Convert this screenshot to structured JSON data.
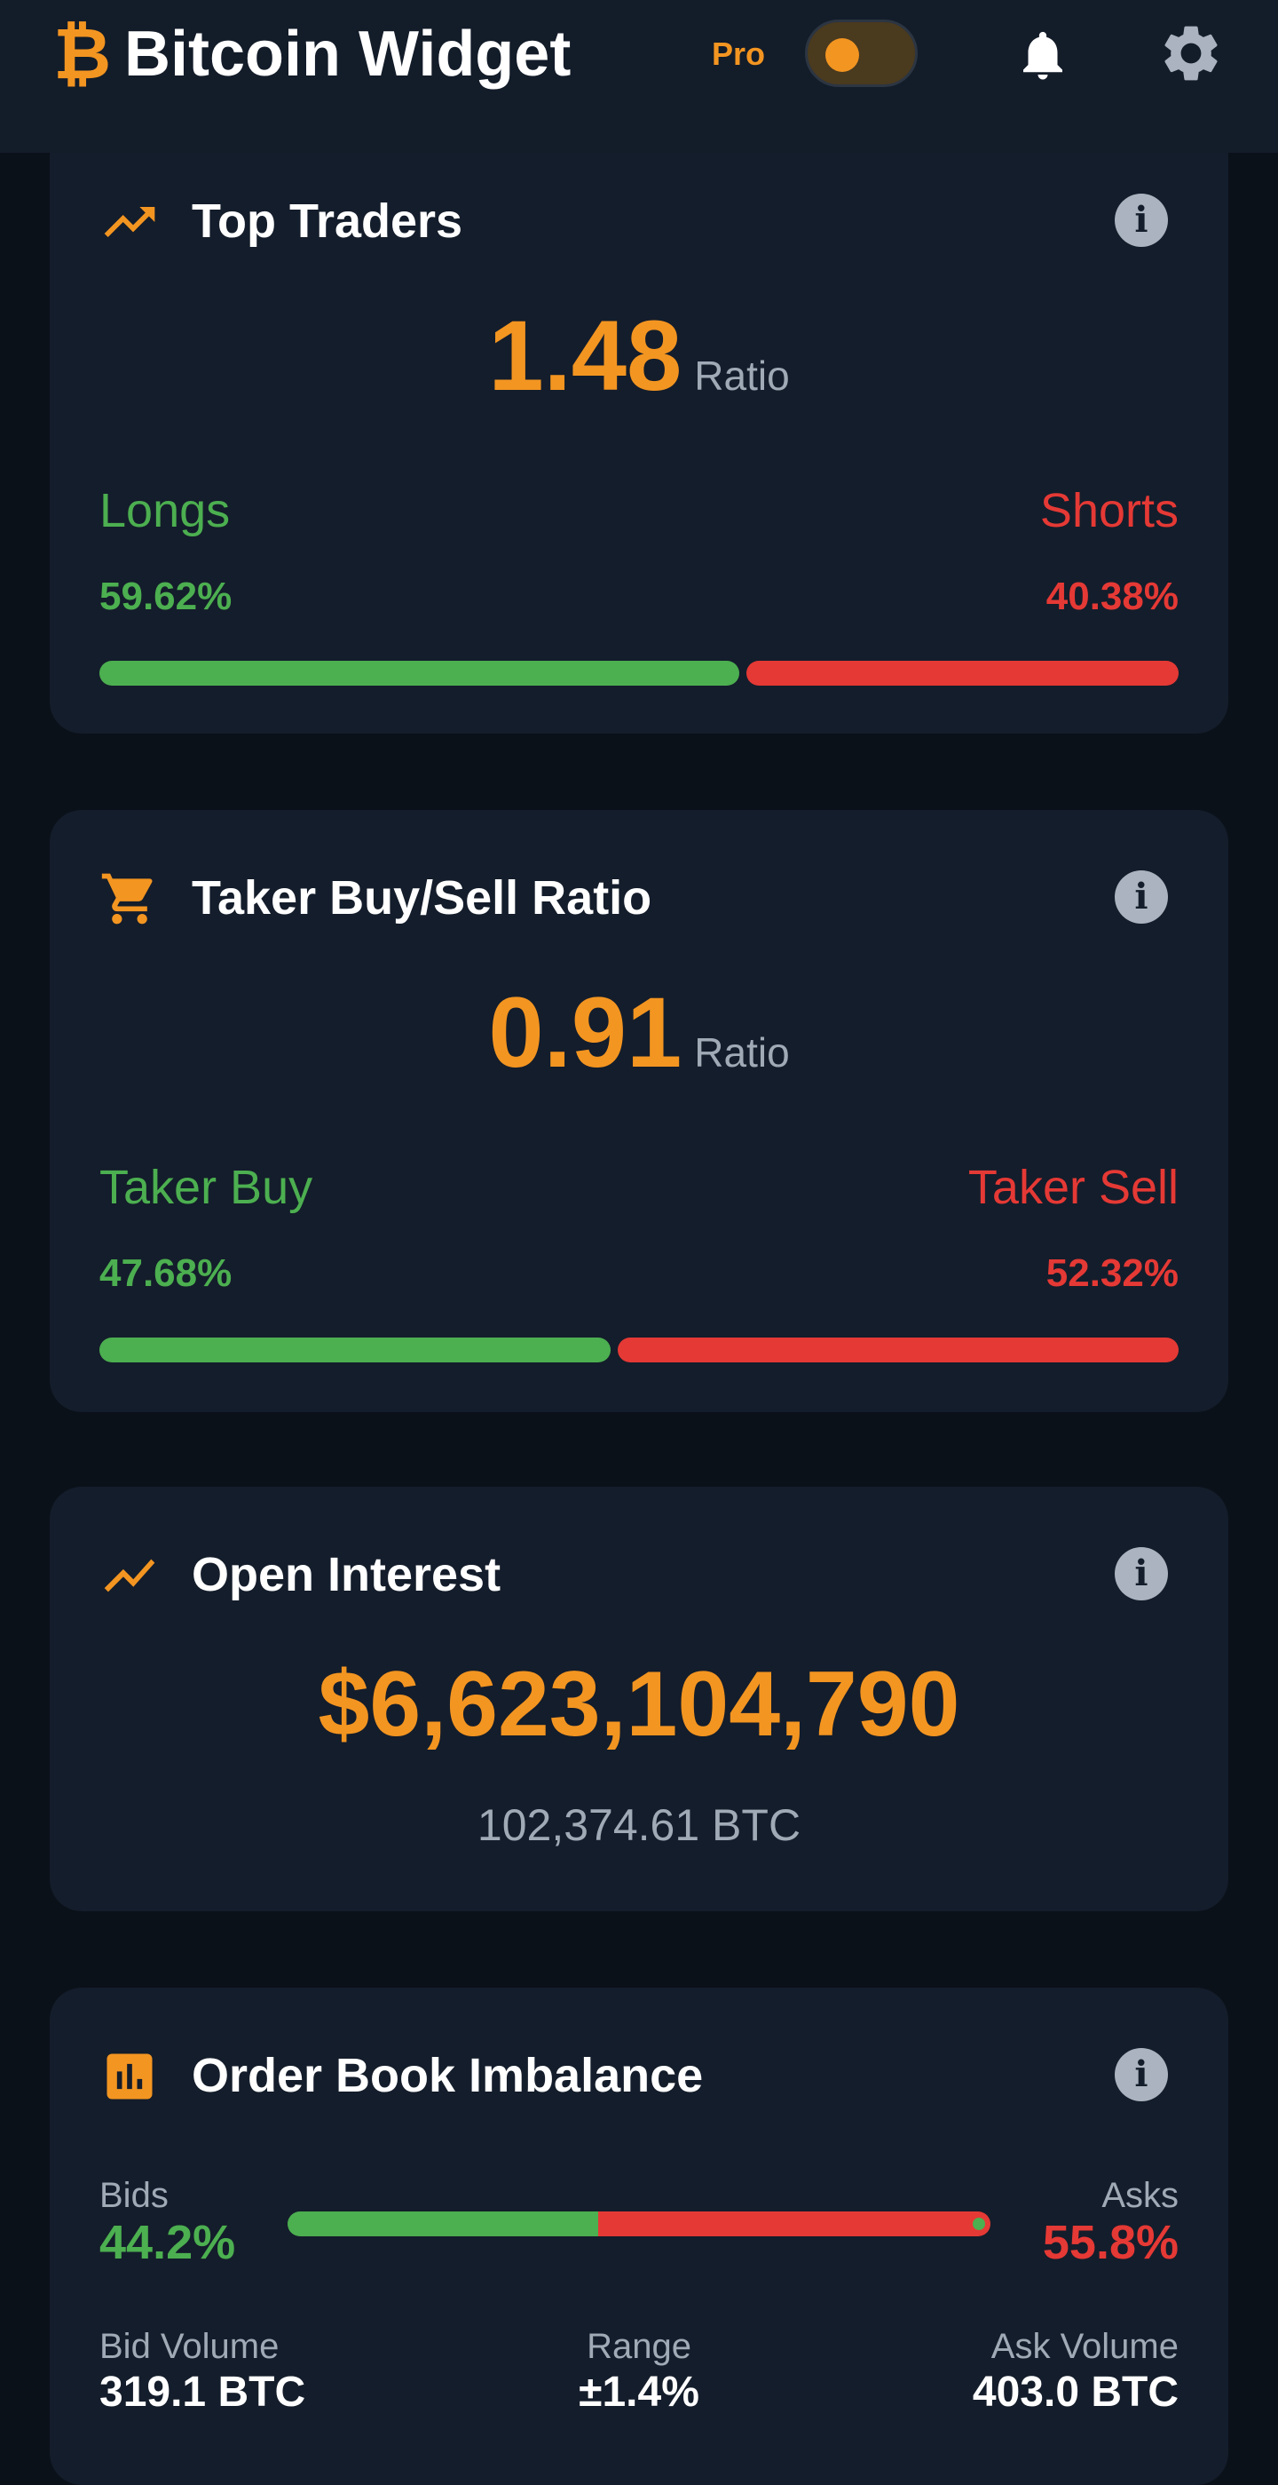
{
  "header": {
    "brand_icon": "₿",
    "title": "Bitcoin Widget",
    "pro_label": "Pro",
    "pro_enabled": true,
    "accent_color": "#f39521"
  },
  "cards": {
    "top_traders": {
      "icon": "trending-up-icon",
      "title": "Top Traders",
      "value": "1.48",
      "unit": "Ratio",
      "left_label": "Longs",
      "left_pct": "59.62%",
      "left_fraction": 0.5962,
      "right_label": "Shorts",
      "right_pct": "40.38%",
      "right_fraction": 0.4038
    },
    "taker_ratio": {
      "icon": "cart-icon",
      "title": "Taker Buy/Sell Ratio",
      "value": "0.91",
      "unit": "Ratio",
      "left_label": "Taker Buy",
      "left_pct": "47.68%",
      "left_fraction": 0.4768,
      "right_label": "Taker Sell",
      "right_pct": "52.32%",
      "right_fraction": 0.5232
    },
    "open_interest": {
      "icon": "line-chart-icon",
      "title": "Open Interest",
      "value": "$6,623,104,790",
      "sub_value": "102,374.61 BTC"
    },
    "order_book": {
      "icon": "bar-chart-icon",
      "title": "Order Book Imbalance",
      "bids_label": "Bids",
      "bids_pct": "44.2%",
      "bids_fraction": 0.442,
      "asks_label": "Asks",
      "asks_pct": "55.8%",
      "bid_volume_label": "Bid Volume",
      "bid_volume": "319.1 BTC",
      "range_label": "Range",
      "range_value": "±1.4%",
      "ask_volume_label": "Ask Volume",
      "ask_volume": "403.0 BTC"
    }
  },
  "colors": {
    "positive": "#4caf50",
    "negative": "#e53935",
    "card_bg": "#141d2b",
    "page_bg": "#0b1119"
  }
}
